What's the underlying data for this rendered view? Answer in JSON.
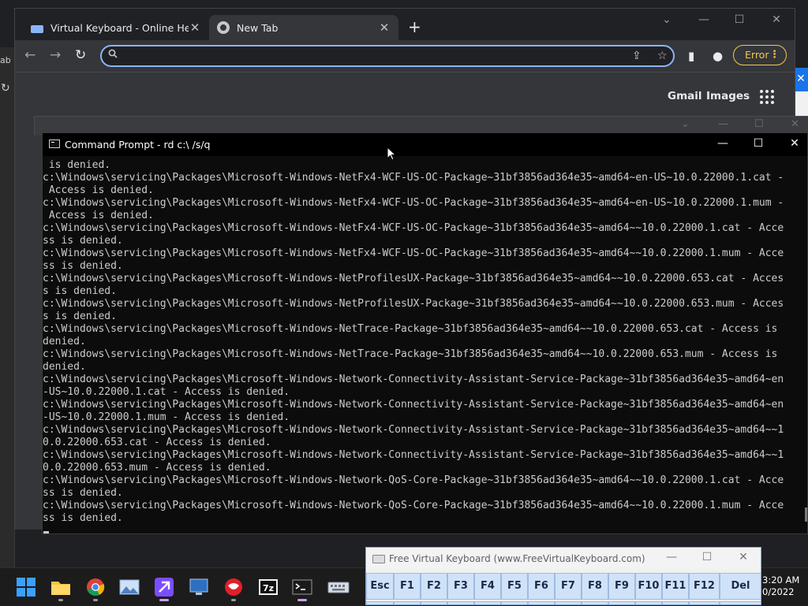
{
  "background": {
    "left_window_label": "ab",
    "right_close_glyph": "✕"
  },
  "chrome": {
    "tabs": [
      {
        "title": "Virtual Keyboard - Online Help",
        "close": "✕",
        "icon": "keyboard-favicon"
      },
      {
        "title": "New Tab",
        "close": "✕",
        "icon": "chrome-favicon"
      }
    ],
    "new_tab_glyph": "+",
    "window_buttons": {
      "dropdown": "⌄",
      "minimize": "—",
      "maximize": "☐",
      "close": "✕"
    },
    "nav": {
      "back": "←",
      "forward": "→",
      "reload": "↻"
    },
    "omnibox": {
      "value": "",
      "placeholder": ""
    },
    "omnibox_icons": {
      "share": "⇪",
      "bookmark": "☆"
    },
    "toolbar_icons": {
      "sidepanel": "▮",
      "profile": "●"
    },
    "error_pill": {
      "label": "Error",
      "menu": "⋮"
    },
    "content_links": {
      "gmail": "Gmail",
      "images": "Images"
    },
    "ghost_buttons": {
      "dropdown": "⌄",
      "minimize": "—",
      "maximize": "☐",
      "close": "✕"
    }
  },
  "cmd": {
    "title": "Command Prompt - rd  c:\\ /s/q",
    "window_buttons": {
      "minimize": "—",
      "maximize": "☐",
      "close": "✕"
    },
    "lines": [
      " is denied.",
      "c:\\Windows\\servicing\\Packages\\Microsoft-Windows-NetFx4-WCF-US-OC-Package~31bf3856ad364e35~amd64~en-US~10.0.22000.1.cat -",
      " Access is denied.",
      "c:\\Windows\\servicing\\Packages\\Microsoft-Windows-NetFx4-WCF-US-OC-Package~31bf3856ad364e35~amd64~en-US~10.0.22000.1.mum -",
      " Access is denied.",
      "c:\\Windows\\servicing\\Packages\\Microsoft-Windows-NetFx4-WCF-US-OC-Package~31bf3856ad364e35~amd64~~10.0.22000.1.cat - Acce",
      "ss is denied.",
      "c:\\Windows\\servicing\\Packages\\Microsoft-Windows-NetFx4-WCF-US-OC-Package~31bf3856ad364e35~amd64~~10.0.22000.1.mum - Acce",
      "ss is denied.",
      "c:\\Windows\\servicing\\Packages\\Microsoft-Windows-NetProfilesUX-Package~31bf3856ad364e35~amd64~~10.0.22000.653.cat - Acces",
      "s is denied.",
      "c:\\Windows\\servicing\\Packages\\Microsoft-Windows-NetProfilesUX-Package~31bf3856ad364e35~amd64~~10.0.22000.653.mum - Acces",
      "s is denied.",
      "c:\\Windows\\servicing\\Packages\\Microsoft-Windows-NetTrace-Package~31bf3856ad364e35~amd64~~10.0.22000.653.cat - Access is",
      "denied.",
      "c:\\Windows\\servicing\\Packages\\Microsoft-Windows-NetTrace-Package~31bf3856ad364e35~amd64~~10.0.22000.653.mum - Access is",
      "denied.",
      "c:\\Windows\\servicing\\Packages\\Microsoft-Windows-Network-Connectivity-Assistant-Service-Package~31bf3856ad364e35~amd64~en",
      "-US~10.0.22000.1.cat - Access is denied.",
      "c:\\Windows\\servicing\\Packages\\Microsoft-Windows-Network-Connectivity-Assistant-Service-Package~31bf3856ad364e35~amd64~en",
      "-US~10.0.22000.1.mum - Access is denied.",
      "c:\\Windows\\servicing\\Packages\\Microsoft-Windows-Network-Connectivity-Assistant-Service-Package~31bf3856ad364e35~amd64~~1",
      "0.0.22000.653.cat - Access is denied.",
      "c:\\Windows\\servicing\\Packages\\Microsoft-Windows-Network-Connectivity-Assistant-Service-Package~31bf3856ad364e35~amd64~~1",
      "0.0.22000.653.mum - Access is denied.",
      "c:\\Windows\\servicing\\Packages\\Microsoft-Windows-Network-QoS-Core-Package~31bf3856ad364e35~amd64~~10.0.22000.1.cat - Acce",
      "ss is denied.",
      "c:\\Windows\\servicing\\Packages\\Microsoft-Windows-Network-QoS-Core-Package~31bf3856ad364e35~amd64~~10.0.22000.1.mum - Acce",
      "ss is denied."
    ]
  },
  "taskbar": {
    "apps": [
      {
        "name": "start-icon"
      },
      {
        "name": "file-explorer-icon"
      },
      {
        "name": "chrome-icon"
      },
      {
        "name": "photos-icon"
      },
      {
        "name": "app-store-icon",
        "active": true
      },
      {
        "name": "remote-desktop-icon"
      },
      {
        "name": "media-player-icon"
      },
      {
        "name": "7zip-icon"
      },
      {
        "name": "command-prompt-icon",
        "active": true
      },
      {
        "name": "virtual-keyboard-icon"
      }
    ],
    "clock": {
      "time": "3:20 AM",
      "date": "0/2022"
    }
  },
  "virtual_keyboard": {
    "title": "Free Virtual Keyboard (www.FreeVirtualKeyboard.com)",
    "window_buttons": {
      "minimize": "—",
      "maximize": "☐",
      "close": "✕"
    },
    "keys": [
      "Esc",
      "F1",
      "F2",
      "F3",
      "F4",
      "F5",
      "F6",
      "F7",
      "F8",
      "F9",
      "F10",
      "F11",
      "F12",
      "Del"
    ]
  },
  "colors": {
    "chrome_dark": "#202124",
    "chrome_toolbar": "#35363a",
    "omnibox_focus": "#8ab4f8",
    "error_pill": "#f2c94c",
    "cmd_bg": "#0c0c0c",
    "cmd_text": "#cccccc",
    "vk_key": "#cfe2f7"
  }
}
